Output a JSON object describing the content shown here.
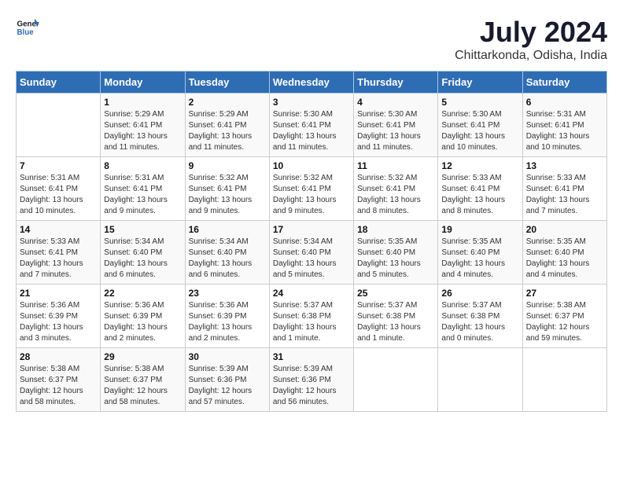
{
  "header": {
    "logo_general": "General",
    "logo_blue": "Blue",
    "title": "July 2024",
    "subtitle": "Chittarkonda, Odisha, India"
  },
  "columns": [
    "Sunday",
    "Monday",
    "Tuesday",
    "Wednesday",
    "Thursday",
    "Friday",
    "Saturday"
  ],
  "weeks": [
    [
      {
        "num": "",
        "info": ""
      },
      {
        "num": "1",
        "info": "Sunrise: 5:29 AM\nSunset: 6:41 PM\nDaylight: 13 hours\nand 11 minutes."
      },
      {
        "num": "2",
        "info": "Sunrise: 5:29 AM\nSunset: 6:41 PM\nDaylight: 13 hours\nand 11 minutes."
      },
      {
        "num": "3",
        "info": "Sunrise: 5:30 AM\nSunset: 6:41 PM\nDaylight: 13 hours\nand 11 minutes."
      },
      {
        "num": "4",
        "info": "Sunrise: 5:30 AM\nSunset: 6:41 PM\nDaylight: 13 hours\nand 11 minutes."
      },
      {
        "num": "5",
        "info": "Sunrise: 5:30 AM\nSunset: 6:41 PM\nDaylight: 13 hours\nand 10 minutes."
      },
      {
        "num": "6",
        "info": "Sunrise: 5:31 AM\nSunset: 6:41 PM\nDaylight: 13 hours\nand 10 minutes."
      }
    ],
    [
      {
        "num": "7",
        "info": "Sunrise: 5:31 AM\nSunset: 6:41 PM\nDaylight: 13 hours\nand 10 minutes."
      },
      {
        "num": "8",
        "info": "Sunrise: 5:31 AM\nSunset: 6:41 PM\nDaylight: 13 hours\nand 9 minutes."
      },
      {
        "num": "9",
        "info": "Sunrise: 5:32 AM\nSunset: 6:41 PM\nDaylight: 13 hours\nand 9 minutes."
      },
      {
        "num": "10",
        "info": "Sunrise: 5:32 AM\nSunset: 6:41 PM\nDaylight: 13 hours\nand 9 minutes."
      },
      {
        "num": "11",
        "info": "Sunrise: 5:32 AM\nSunset: 6:41 PM\nDaylight: 13 hours\nand 8 minutes."
      },
      {
        "num": "12",
        "info": "Sunrise: 5:33 AM\nSunset: 6:41 PM\nDaylight: 13 hours\nand 8 minutes."
      },
      {
        "num": "13",
        "info": "Sunrise: 5:33 AM\nSunset: 6:41 PM\nDaylight: 13 hours\nand 7 minutes."
      }
    ],
    [
      {
        "num": "14",
        "info": "Sunrise: 5:33 AM\nSunset: 6:41 PM\nDaylight: 13 hours\nand 7 minutes."
      },
      {
        "num": "15",
        "info": "Sunrise: 5:34 AM\nSunset: 6:40 PM\nDaylight: 13 hours\nand 6 minutes."
      },
      {
        "num": "16",
        "info": "Sunrise: 5:34 AM\nSunset: 6:40 PM\nDaylight: 13 hours\nand 6 minutes."
      },
      {
        "num": "17",
        "info": "Sunrise: 5:34 AM\nSunset: 6:40 PM\nDaylight: 13 hours\nand 5 minutes."
      },
      {
        "num": "18",
        "info": "Sunrise: 5:35 AM\nSunset: 6:40 PM\nDaylight: 13 hours\nand 5 minutes."
      },
      {
        "num": "19",
        "info": "Sunrise: 5:35 AM\nSunset: 6:40 PM\nDaylight: 13 hours\nand 4 minutes."
      },
      {
        "num": "20",
        "info": "Sunrise: 5:35 AM\nSunset: 6:40 PM\nDaylight: 13 hours\nand 4 minutes."
      }
    ],
    [
      {
        "num": "21",
        "info": "Sunrise: 5:36 AM\nSunset: 6:39 PM\nDaylight: 13 hours\nand 3 minutes."
      },
      {
        "num": "22",
        "info": "Sunrise: 5:36 AM\nSunset: 6:39 PM\nDaylight: 13 hours\nand 2 minutes."
      },
      {
        "num": "23",
        "info": "Sunrise: 5:36 AM\nSunset: 6:39 PM\nDaylight: 13 hours\nand 2 minutes."
      },
      {
        "num": "24",
        "info": "Sunrise: 5:37 AM\nSunset: 6:38 PM\nDaylight: 13 hours\nand 1 minute."
      },
      {
        "num": "25",
        "info": "Sunrise: 5:37 AM\nSunset: 6:38 PM\nDaylight: 13 hours\nand 1 minute."
      },
      {
        "num": "26",
        "info": "Sunrise: 5:37 AM\nSunset: 6:38 PM\nDaylight: 13 hours\nand 0 minutes."
      },
      {
        "num": "27",
        "info": "Sunrise: 5:38 AM\nSunset: 6:37 PM\nDaylight: 12 hours\nand 59 minutes."
      }
    ],
    [
      {
        "num": "28",
        "info": "Sunrise: 5:38 AM\nSunset: 6:37 PM\nDaylight: 12 hours\nand 58 minutes."
      },
      {
        "num": "29",
        "info": "Sunrise: 5:38 AM\nSunset: 6:37 PM\nDaylight: 12 hours\nand 58 minutes."
      },
      {
        "num": "30",
        "info": "Sunrise: 5:39 AM\nSunset: 6:36 PM\nDaylight: 12 hours\nand 57 minutes."
      },
      {
        "num": "31",
        "info": "Sunrise: 5:39 AM\nSunset: 6:36 PM\nDaylight: 12 hours\nand 56 minutes."
      },
      {
        "num": "",
        "info": ""
      },
      {
        "num": "",
        "info": ""
      },
      {
        "num": "",
        "info": ""
      }
    ]
  ]
}
